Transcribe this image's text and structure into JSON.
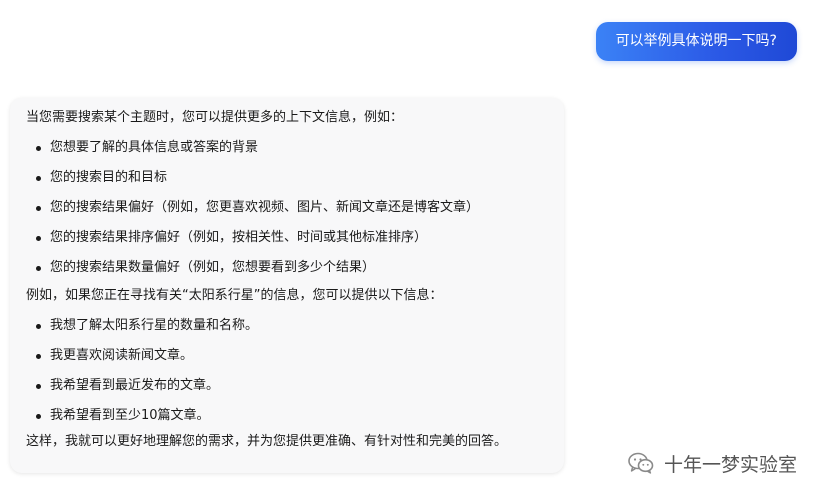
{
  "user_message": {
    "text": "可以举例具体说明一下吗?"
  },
  "assistant_message": {
    "intro": "当您需要搜索某个主题时，您可以提供更多的上下文信息，例如：",
    "bullets_1": [
      "您想要了解的具体信息或答案的背景",
      "您的搜索目的和目标",
      "您的搜索结果偏好（例如，您更喜欢视频、图片、新闻文章还是博客文章）",
      "您的搜索结果排序偏好（例如，按相关性、时间或其他标准排序）",
      "您的搜索结果数量偏好（例如，您想要看到多少个结果）"
    ],
    "example_intro": "例如，如果您正在寻找有关“太阳系行星”的信息，您可以提供以下信息：",
    "bullets_2": [
      "我想了解太阳系行星的数量和名称。",
      "我更喜欢阅读新闻文章。",
      "我希望看到最近发布的文章。",
      "我希望看到至少10篇文章。"
    ],
    "summary": "这样，我就可以更好地理解您的需求，并为您提供更准确、有针对性和完美的回答。"
  },
  "watermark": {
    "icon": "wechat-icon",
    "text": "十年一梦实验室"
  },
  "colors": {
    "user_bubble_start": "#3b82f6",
    "user_bubble_end": "#1f49d6",
    "card_background": "#f8f8f9"
  }
}
